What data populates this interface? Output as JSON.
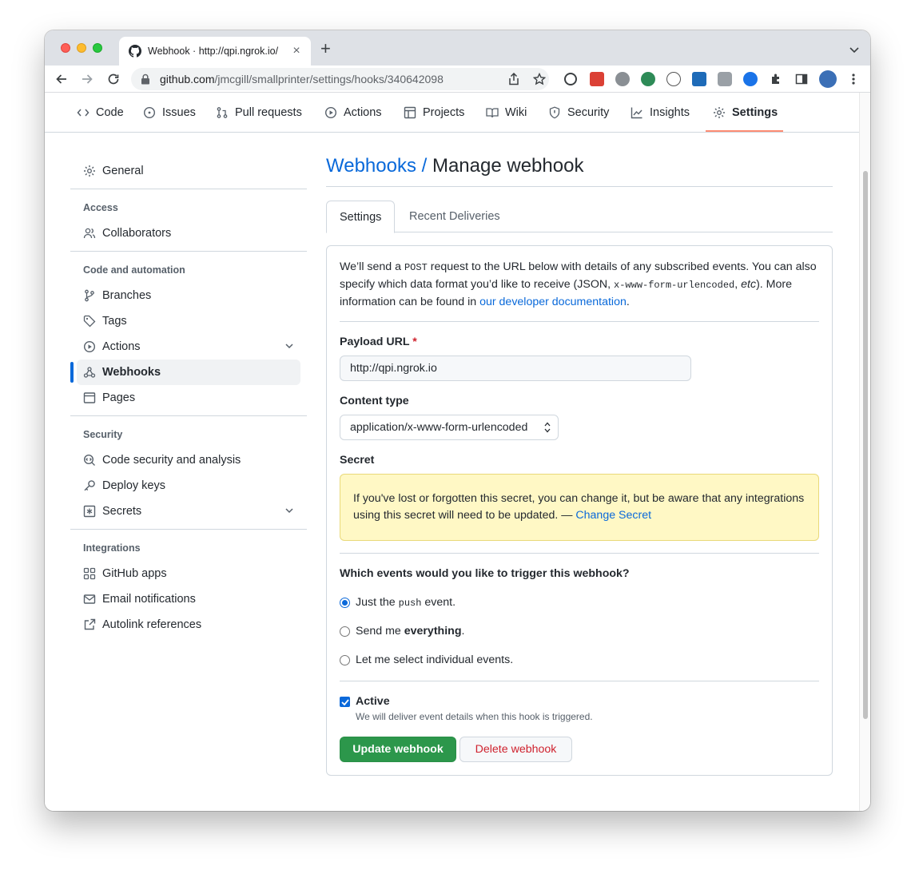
{
  "browser": {
    "tab_title": "Webhook · http://qpi.ngrok.io/",
    "url_host": "github.com",
    "url_path": "/jmcgill/smallprinter/settings/hooks/340642098"
  },
  "repo_nav": {
    "items": [
      {
        "label": "Code"
      },
      {
        "label": "Issues"
      },
      {
        "label": "Pull requests"
      },
      {
        "label": "Actions"
      },
      {
        "label": "Projects"
      },
      {
        "label": "Wiki"
      },
      {
        "label": "Security"
      },
      {
        "label": "Insights"
      },
      {
        "label": "Settings"
      }
    ],
    "selected": "Settings"
  },
  "sidebar": {
    "general": "General",
    "sections": [
      {
        "heading": "Access",
        "items": [
          "Collaborators"
        ]
      },
      {
        "heading": "Code and automation",
        "items": [
          "Branches",
          "Tags",
          "Actions",
          "Webhooks",
          "Pages"
        ]
      },
      {
        "heading": "Security",
        "items": [
          "Code security and analysis",
          "Deploy keys",
          "Secrets"
        ]
      },
      {
        "heading": "Integrations",
        "items": [
          "GitHub apps",
          "Email notifications",
          "Autolink references"
        ]
      }
    ],
    "active": "Webhooks"
  },
  "main": {
    "breadcrumb_link": "Webhooks /",
    "breadcrumb_current": "Manage webhook",
    "tabs": [
      "Settings",
      "Recent Deliveries"
    ],
    "intro": {
      "p1": "We’ll send a ",
      "post": "POST",
      "p2": " request to the URL below with details of any subscribed events. You can also specify which data format you’d like to receive (JSON, ",
      "form": "x-www-form-urlencoded",
      "p3": ", ",
      "etc": "etc",
      "p4": "). More information can be found in ",
      "link": "our developer documentation",
      "p5": "."
    },
    "payload_label": "Payload URL",
    "required_mark": "*",
    "payload_value": "http://qpi.ngrok.io",
    "content_type_label": "Content type",
    "content_type_value": "application/x-www-form-urlencoded",
    "secret_label": "Secret",
    "secret_notice": "If you've lost or forgotten this secret, you can change it, but be aware that any integrations using this secret will need to be updated. — ",
    "secret_link": "Change Secret",
    "events_question": "Which events would you like to trigger this webhook?",
    "event_options": {
      "push_a": "Just the ",
      "push_code": "push",
      "push_b": " event.",
      "all_a": "Send me ",
      "all_b": "everything",
      "all_c": ".",
      "select": "Let me select individual events."
    },
    "active_label": "Active",
    "active_note": "We will deliver event details when this hook is triggered.",
    "update_button": "Update webhook",
    "delete_button": "Delete webhook"
  },
  "colors": {
    "accent": "#0969da",
    "primary_button": "#2c974b",
    "danger": "#cf222e",
    "nav_underline": "#fd8c73",
    "flash_bg": "#fff8c5"
  }
}
